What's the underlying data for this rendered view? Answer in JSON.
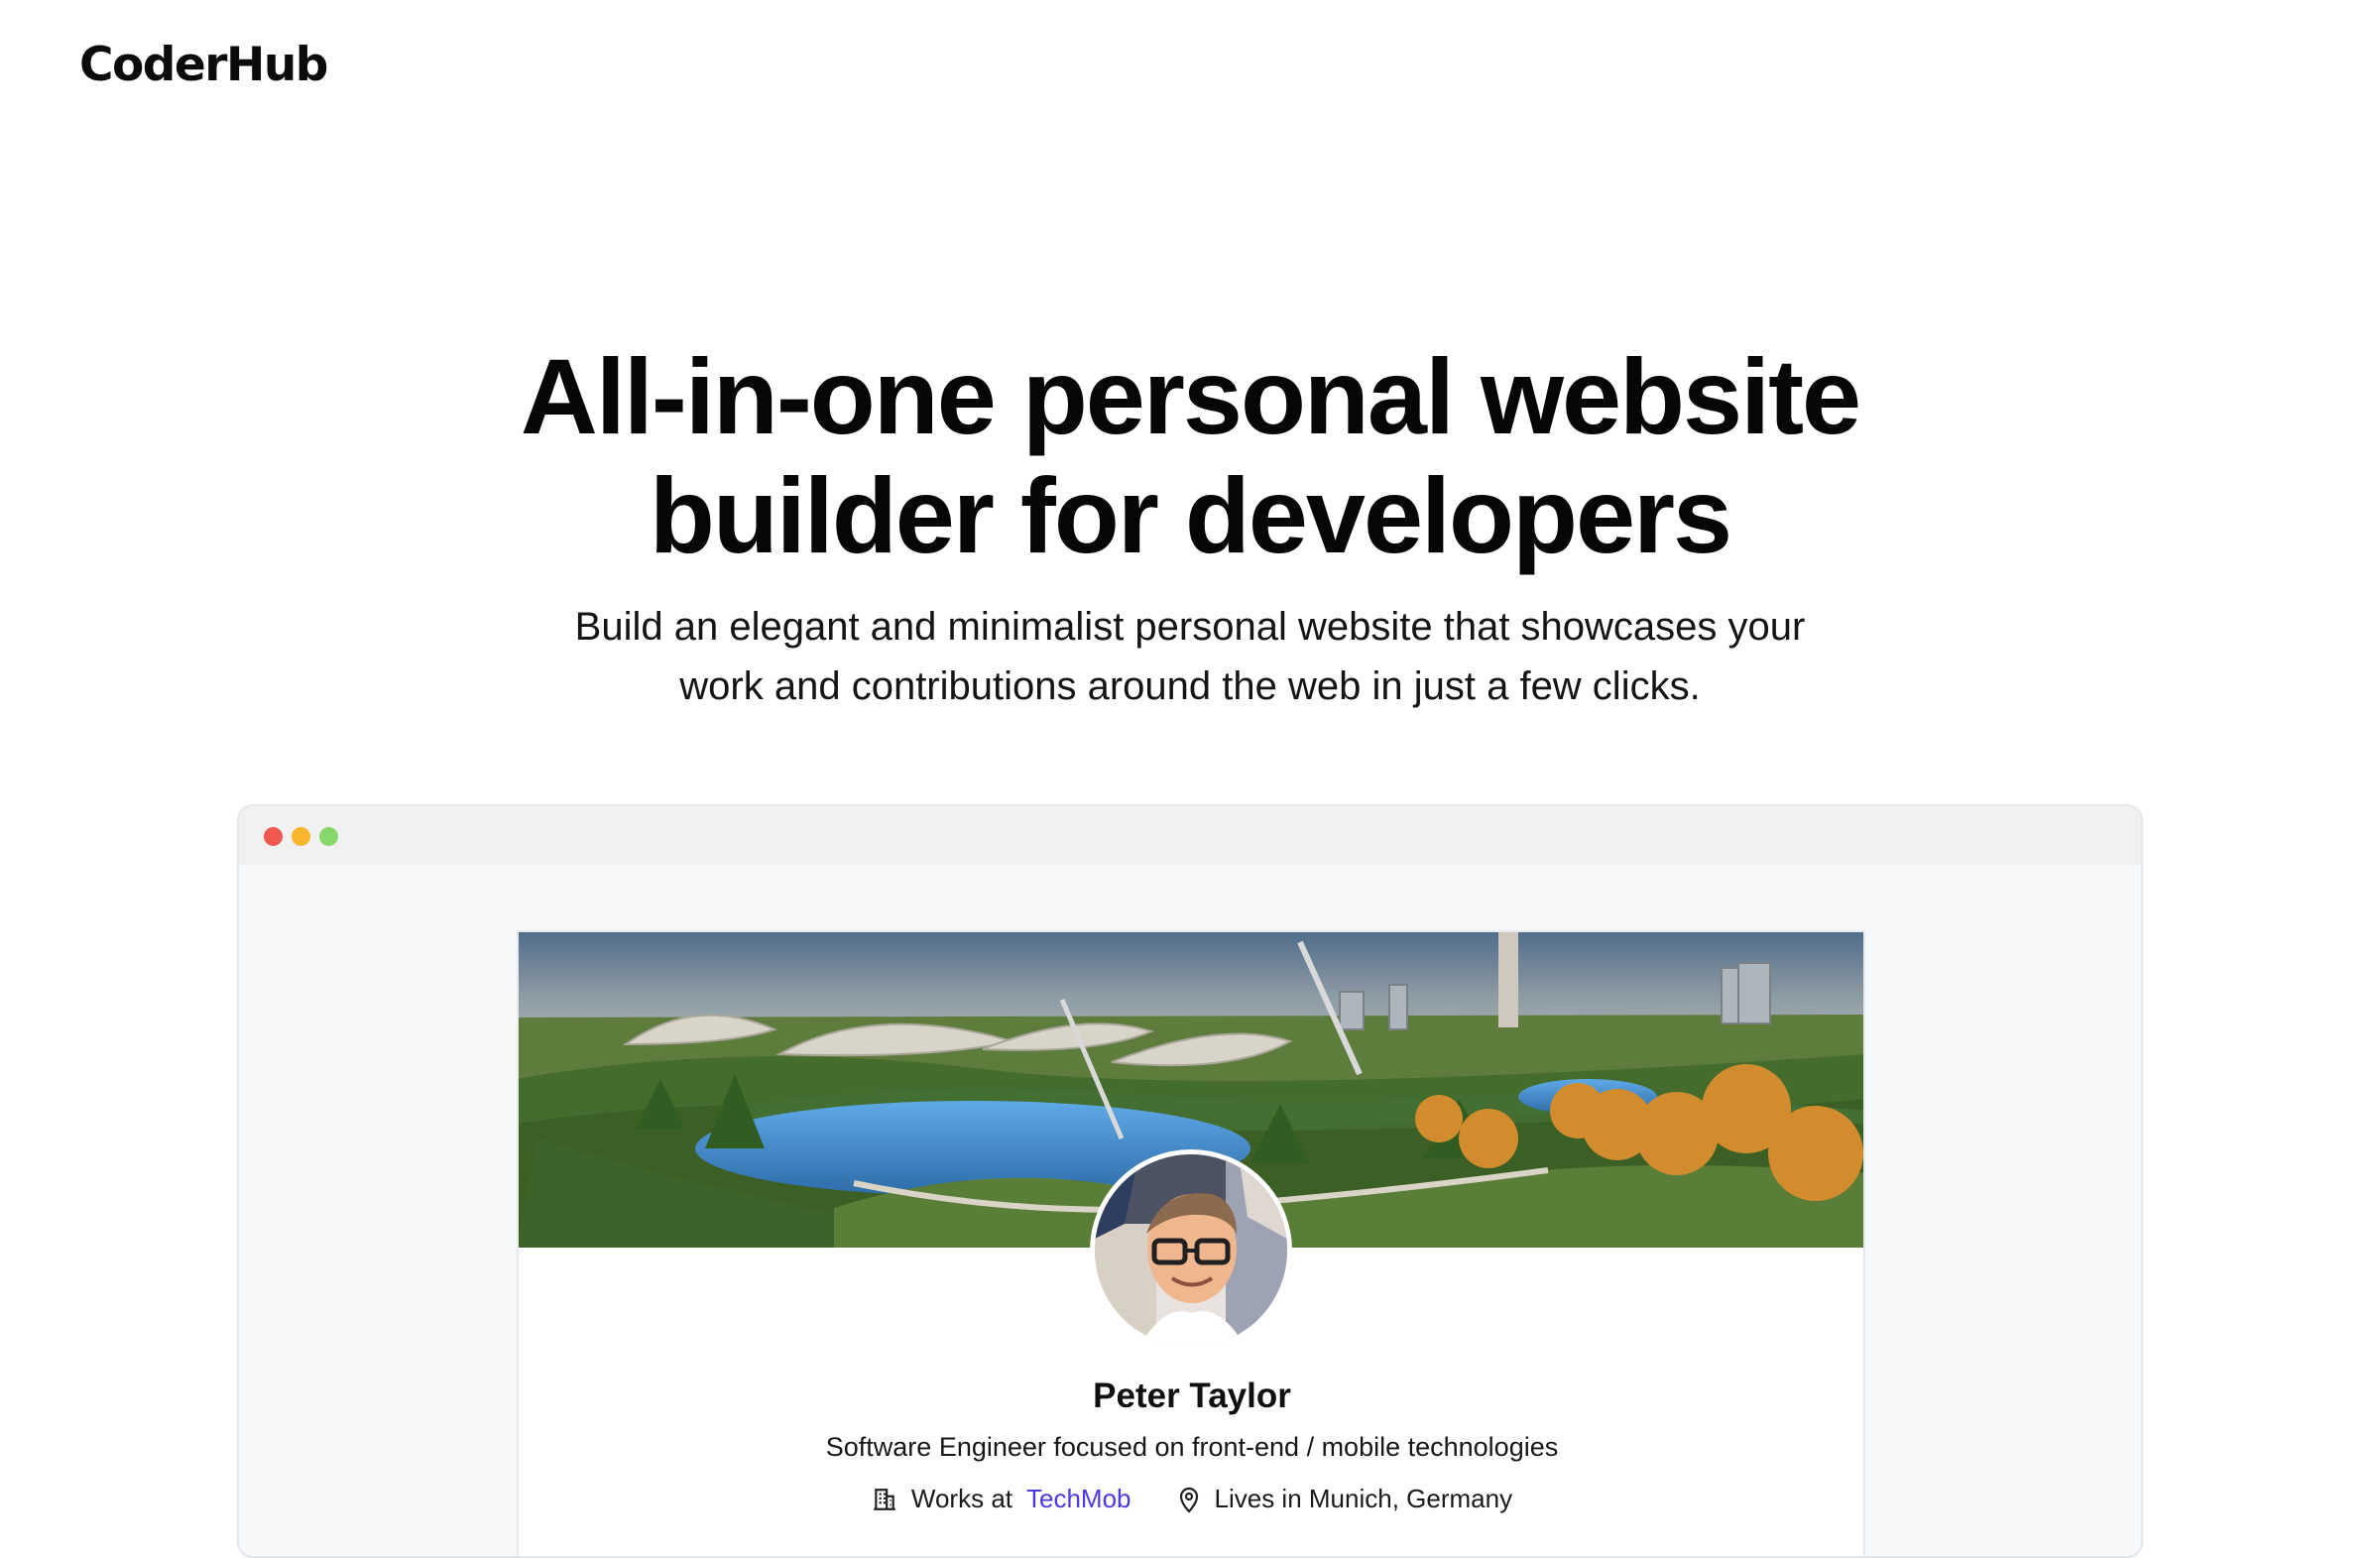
{
  "header": {
    "logo": "CoderHub"
  },
  "hero": {
    "title": "All-in-one personal website builder for developers",
    "subtitle": "Build an elegant and minimalist personal website that showcases your work and contributions around the web in just a few clicks."
  },
  "preview": {
    "window_controls": [
      "close",
      "minimize",
      "maximize"
    ],
    "cover_image": "park-panorama",
    "avatar_image": "profile-photo",
    "profile": {
      "name": "Peter Taylor",
      "bio": "Software Engineer focused on front-end / mobile technologies",
      "works_prefix": "Works at",
      "company": "TechMob",
      "location": "Lives in Munich, Germany"
    }
  },
  "colors": {
    "link": "#4b3ae0",
    "close": "#f0584f",
    "minimize": "#f7b62d",
    "maximize": "#87d86a"
  }
}
